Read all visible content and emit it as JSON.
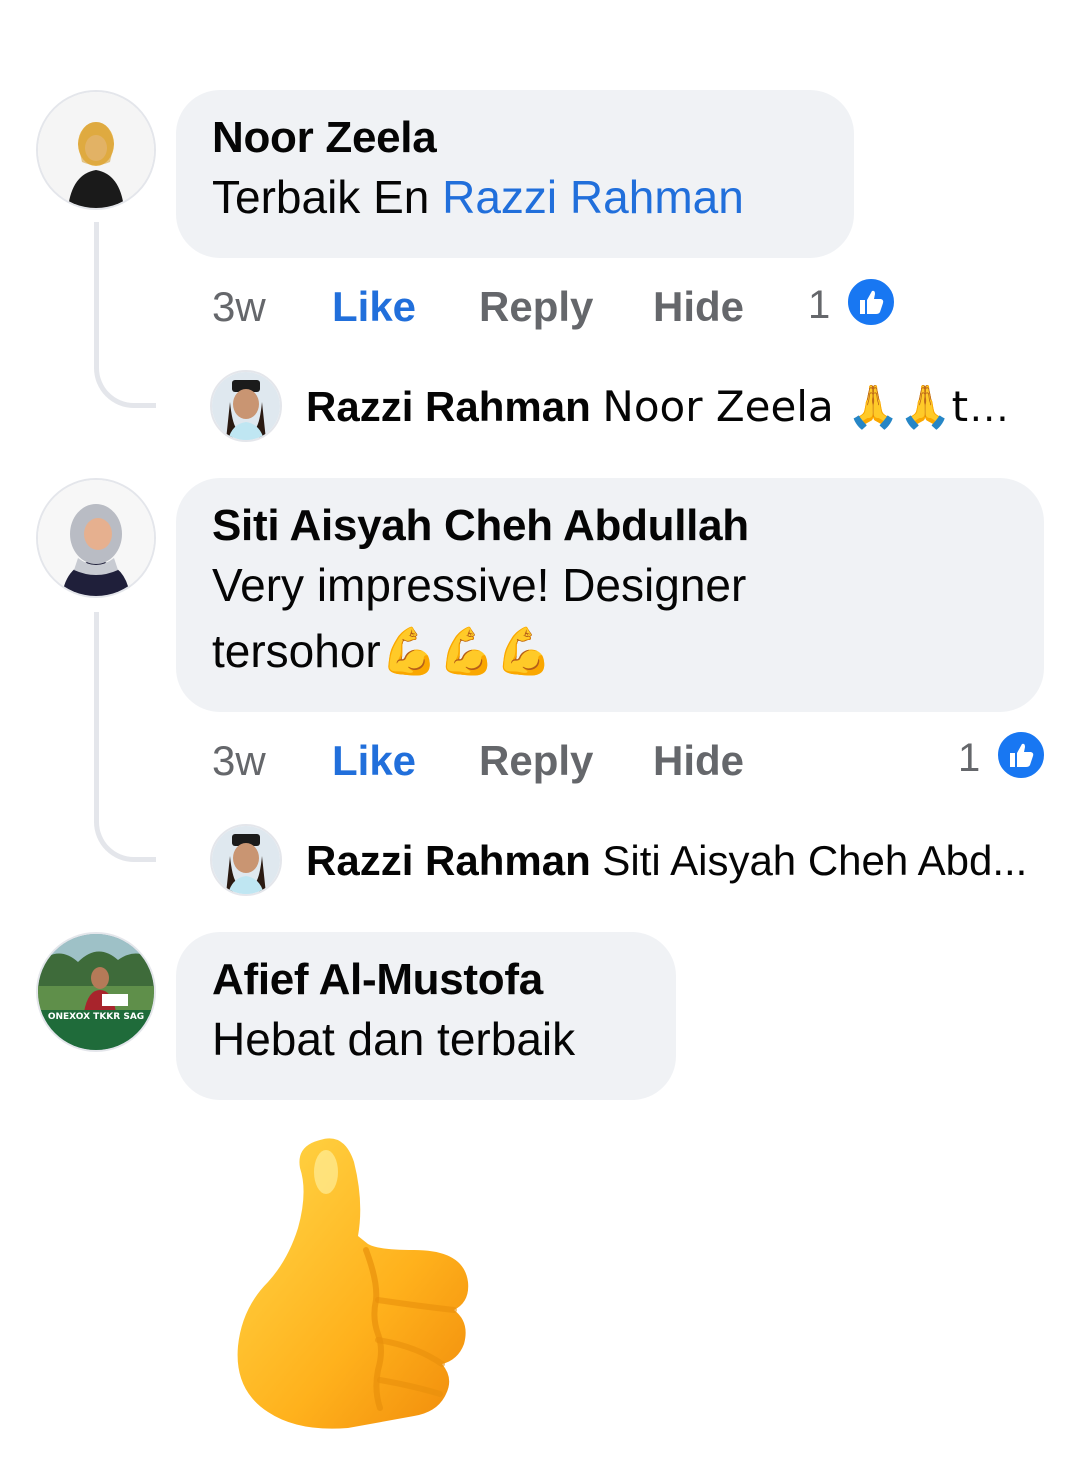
{
  "comments": [
    {
      "author": "Noor Zeela",
      "text_plain": "Terbaik En ",
      "text_mention": "Razzi Rahman",
      "time": "3w",
      "like_label": "Like",
      "reply_label": "Reply",
      "hide_label": "Hide",
      "reaction_count": "1",
      "reply": {
        "author": "Razzi Rahman",
        "text": "Noor Zeela 🙏🙏tha..."
      }
    },
    {
      "author": "Siti Aisyah Cheh Abdullah",
      "text_line1": "Very impressive! Designer",
      "text_line2": "tersohor",
      "emojis": "💪💪💪",
      "time": "3w",
      "like_label": "Like",
      "reply_label": "Reply",
      "hide_label": "Hide",
      "reaction_count": "1",
      "reply": {
        "author": "Razzi Rahman",
        "text": "Siti Aisyah Cheh Abd..."
      }
    },
    {
      "author": "Afief Al-Mustofa",
      "text": "Hebat dan terbaik",
      "avatar_caption": "ONEXOX TKKR SAG",
      "sticker": "thumbs-up"
    }
  ],
  "colors": {
    "bubble": "#f0f2f5",
    "link": "#216fdb",
    "meta": "#65676b",
    "like_badge": "#1877f2"
  }
}
